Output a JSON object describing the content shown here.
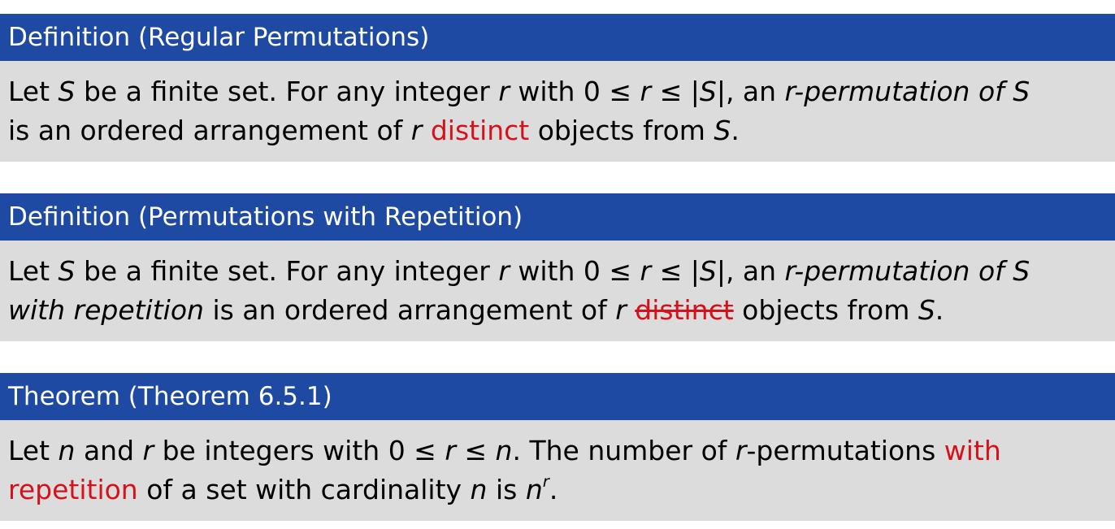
{
  "blocks": [
    {
      "header": "Definition (Regular Permutations)",
      "body": {
        "line1": {
          "t1": "Let ",
          "m1": "S",
          "t2": " be a finite set. For any integer ",
          "m2": "r",
          "t3": " with ",
          "m3": "0 ≤ ",
          "m4": "r",
          "m5": " ≤ |",
          "m6": "S",
          "m7": "|",
          "t4": ", an ",
          "i1": "r-permutation of ",
          "m8": "S"
        },
        "line2": {
          "t1": "is an ordered arrangement of ",
          "m1": "r",
          "red1": "distinct",
          "t2": " objects from ",
          "m2": "S",
          "t3": "."
        }
      }
    },
    {
      "header": "Definition (Permutations with Repetition)",
      "body": {
        "line1": {
          "t1": "Let ",
          "m1": "S",
          "t2": " be a finite set. For any integer ",
          "m2": "r",
          "t3": " with ",
          "m3": "0 ≤ ",
          "m4": "r",
          "m5": " ≤ |",
          "m6": "S",
          "m7": "|",
          "t4": ", an ",
          "i1": "r-permutation of ",
          "m8": "S"
        },
        "line2": {
          "i1": "with repetition",
          "t1": " is an ordered arrangement of ",
          "m1": "r",
          "strike1": "distinct",
          "t2": " objects from ",
          "m2": "S",
          "t3": "."
        }
      }
    },
    {
      "header": "Theorem (Theorem 6.5.1)",
      "body": {
        "line1": {
          "t1": "Let ",
          "m1": "n",
          "t2": " and ",
          "m2": "r",
          "t3": " be integers with ",
          "m3": "0 ≤ ",
          "m4": "r",
          "m5": " ≤ ",
          "m6": "n",
          "t4": ". The number of ",
          "m7": "r",
          "t5": "-permutations ",
          "red1": "with"
        },
        "line2": {
          "red1": "repetition",
          "t1": " of a set with cardinality ",
          "m1": "n",
          "t2": " is ",
          "m2": "n",
          "sup1": "r",
          "t3": "."
        }
      }
    }
  ],
  "colors": {
    "header_bg": "#1f4aa3",
    "body_bg": "#dcdcdc",
    "accent_red": "#d3121b"
  }
}
